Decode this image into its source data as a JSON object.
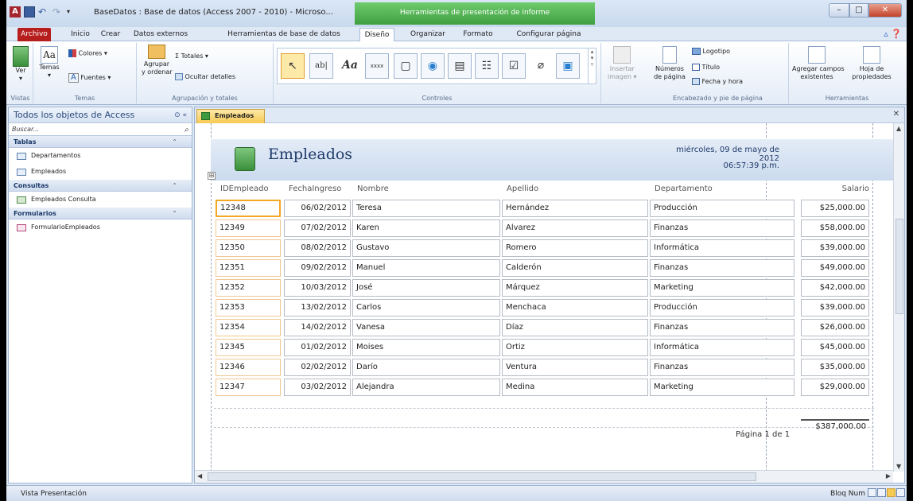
{
  "window": {
    "title": "BaseDatos : Base de datos (Access 2007 - 2010) - Microso...",
    "context_title": "Herramientas de presentación de informe",
    "app_icon": "A"
  },
  "tabs": [
    "Archivo",
    "Inicio",
    "Crear",
    "Datos externos",
    "Herramientas de base de datos",
    "Diseño",
    "Organizar",
    "Formato",
    "Configurar página"
  ],
  "ribbon": {
    "vistas": {
      "ver": "Ver",
      "label": "Vistas"
    },
    "temas": {
      "temas": "Temas",
      "colores": "Colores ▾",
      "fuentes": "Fuentes ▾",
      "label": "Temas"
    },
    "agrupacion": {
      "agrupar": "Agrupar",
      "agrupar2": "y ordenar",
      "totales": "Σ Totales ▾",
      "ocultar": "Ocultar detalles",
      "label": "Agrupación y totales"
    },
    "controles": {
      "label": "Controles",
      "insertar": "Insertar",
      "insertar2": "imagen ▾"
    },
    "encabezado": {
      "numeros": "Números",
      "numeros2": "de página",
      "logotipo": "Logotipo",
      "titulo": "Título",
      "fecha": "Fecha y hora",
      "label": "Encabezado y pie de página"
    },
    "herramientas": {
      "agregar": "Agregar campos",
      "agregar2": "existentes",
      "hoja": "Hoja de",
      "hoja2": "propiedades",
      "label": "Herramientas"
    }
  },
  "nav": {
    "title": "Todos los objetos de Access",
    "search_placeholder": "Buscar...",
    "sections": [
      {
        "name": "Tablas",
        "items": [
          "Departamentos",
          "Empleados"
        ]
      },
      {
        "name": "Consultas",
        "items": [
          "Empleados Consulta"
        ]
      },
      {
        "name": "Formularios",
        "items": [
          "FormularioEmpleados"
        ]
      }
    ]
  },
  "document": {
    "tab": "Empleados",
    "report_title": "Empleados",
    "date": "miércoles, 09 de mayo de 2012",
    "time": "06:57:39 p.m.",
    "columns": [
      "IDEmpleado",
      "FechaIngreso",
      "Nombre",
      "Apellido",
      "Departamento",
      "Salario"
    ],
    "rows": [
      [
        "12348",
        "06/02/2012",
        "Teresa",
        "Hernández",
        "Producción",
        "$25,000.00"
      ],
      [
        "12349",
        "07/02/2012",
        "Karen",
        "Alvarez",
        "Finanzas",
        "$58,000.00"
      ],
      [
        "12350",
        "08/02/2012",
        "Gustavo",
        "Romero",
        "Informática",
        "$39,000.00"
      ],
      [
        "12351",
        "09/02/2012",
        "Manuel",
        "Calderón",
        "Finanzas",
        "$49,000.00"
      ],
      [
        "12352",
        "10/03/2012",
        "José",
        "Márquez",
        "Marketing",
        "$42,000.00"
      ],
      [
        "12353",
        "13/02/2012",
        "Carlos",
        "Menchaca",
        "Producción",
        "$39,000.00"
      ],
      [
        "12354",
        "14/02/2012",
        "Vanesa",
        "Díaz",
        "Finanzas",
        "$26,000.00"
      ],
      [
        "12345",
        "01/02/2012",
        "Moises",
        "Ortiz",
        "Informática",
        "$45,000.00"
      ],
      [
        "12346",
        "02/02/2012",
        "Darío",
        "Ventura",
        "Finanzas",
        "$35,000.00"
      ],
      [
        "12347",
        "03/02/2012",
        "Alejandra",
        "Medina",
        "Marketing",
        "$29,000.00"
      ]
    ],
    "total": "$387,000.00",
    "page": "Página 1 de 1"
  },
  "status": {
    "left": "Vista Presentación",
    "right": "Bloq Num"
  }
}
